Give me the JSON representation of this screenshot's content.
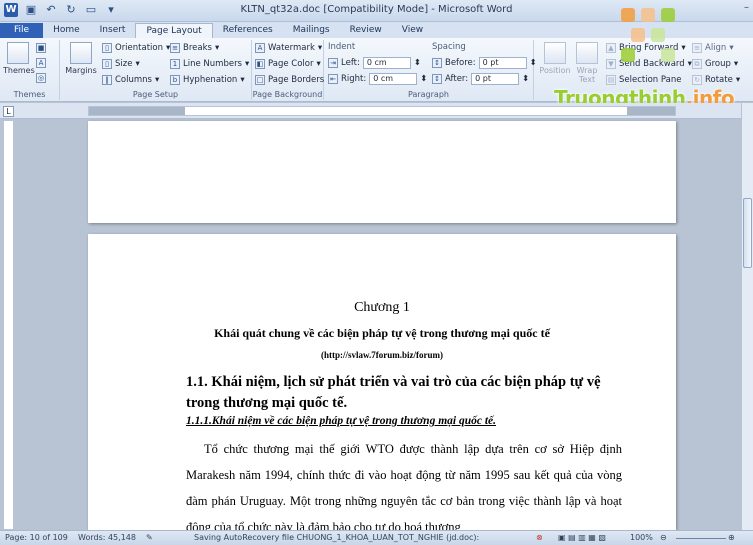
{
  "window": {
    "title": "KLTN_qt32a.doc [Compatibility Mode] - Microsoft Word"
  },
  "tabs": [
    "File",
    "Home",
    "Insert",
    "Page Layout",
    "References",
    "Mailings",
    "Review",
    "View"
  ],
  "active_tab": "Page Layout",
  "ribbon": {
    "themes": {
      "label": "Themes",
      "group": "Themes"
    },
    "page_setup": {
      "group": "Page Setup",
      "margins": "Margins",
      "orientation": "Orientation",
      "size": "Size",
      "columns": "Columns",
      "breaks": "Breaks",
      "line_numbers": "Line Numbers",
      "hyphenation": "Hyphenation"
    },
    "page_background": {
      "group": "Page Background",
      "watermark": "Watermark",
      "page_color": "Page Color",
      "page_borders": "Page Borders"
    },
    "paragraph": {
      "group": "Paragraph",
      "indent": "Indent",
      "left": "Left:",
      "left_value": "0 cm",
      "right": "Right:",
      "right_value": "0 cm",
      "spacing": "Spacing",
      "before": "Before:",
      "before_value": "0 pt",
      "after": "After:",
      "after_value": "0 pt"
    },
    "arrange": {
      "position": "Position",
      "wrap_text": "Wrap Text",
      "bring_forward": "Bring Forward",
      "send_backward": "Send Backward",
      "selection_pane": "Selection Pane",
      "align": "Align",
      "group_btn": "Group",
      "rotate": "Rotate"
    }
  },
  "watermark_logo": {
    "part1": "Truongthinh",
    "part2": ".info"
  },
  "document": {
    "chapter": "Chương 1",
    "heading": "Khái quát chung về các biện pháp tự vệ trong thương mại quốc tế",
    "url": "(http://svlaw.7forum.biz/forum)",
    "section_1_1": "1.1. Khái niệm, lịch sử phát triển và vai trò của các biện pháp tự vệ trong thương mại quốc tế.",
    "section_1_1_1": "1.1.1.Khái niệm về các biện pháp tự vệ trong thương mại quốc tế.",
    "paragraph": "Tổ chức thương mại thế giới WTO được thành lập dựa trên cơ sở Hiệp định Marakesh năm 1994, chính thức đi vào hoạt động từ năm 1995 sau kết quả của vòng đàm phán Uruguay. Một trong những nguyên tắc cơ bản trong việc thành lập và hoạt động của tổ chức này là đảm bảo cho tự do hoá thương"
  },
  "status_bar": {
    "page": "Page: 10 of 109",
    "words": "Words: 45,148",
    "saving": "Saving AutoRecovery file CHUONG_1_KHOA_LUAN_TOT_NGHIE (jd.doc):",
    "zoom": "100%"
  }
}
